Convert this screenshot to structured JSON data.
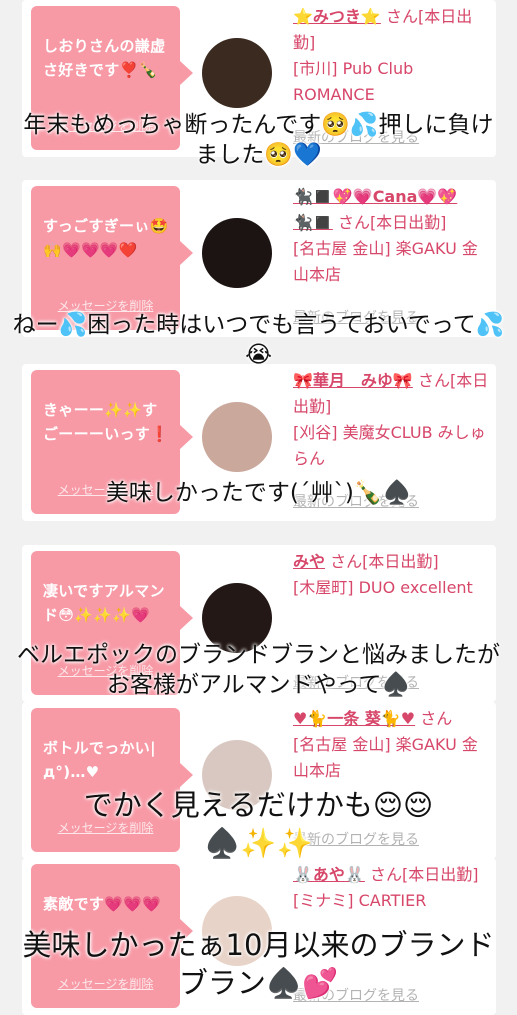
{
  "cards": [
    {
      "bubble_text": "しおりさんの謙虚さ好きです❣️🍾",
      "delete_label": "メッセージを削除",
      "name": "⭐️みつき⭐️",
      "san": "さん[本日出勤]",
      "store": "[市川] Pub Club ROMANCE",
      "blog_label": "最新のブログを見る",
      "avatar_color": "#3a2a20"
    },
    {
      "bubble_text": "すっごすぎーぃ🤩🙌💗💗💗❤️",
      "delete_label": "メッセージを削除",
      "name": "🐈‍⬛◼️💖💗Cana💗💖🐈‍⬛◼️",
      "san": "さん[本日出勤]",
      "store": "[名古屋 金山] 楽GAKU 金山本店",
      "blog_label": "最新のブログを見る",
      "avatar_color": "#1b1412"
    },
    {
      "bubble_text": "きゃーー✨✨すごーーーいっす❗️",
      "delete_label": "メッセージを削除",
      "name": "🎀華月　みゆ🎀",
      "san": "さん[本日出勤]",
      "store": "[刈谷] 美魔女CLUB みしゅらん",
      "blog_label": "最新のブログを見る",
      "avatar_color": "#caa89c"
    },
    {
      "bubble_text": "凄いですアルマンド😳✨✨✨💗",
      "delete_label": "メッセージを削除",
      "name": "みや",
      "san": "さん[本日出勤]",
      "store": "[木屋町] DUO excellent",
      "blog_label": "最新のブログを見る",
      "avatar_color": "#231815"
    },
    {
      "bubble_text": "ボトルでっかい|д°)…♥",
      "delete_label": "メッセージを削除",
      "name": "♥🐈一条 葵🐈♥",
      "san": "さん",
      "store": "[名古屋 金山] 楽GAKU 金山本店",
      "blog_label": "最新のブログを見る",
      "avatar_color": "#d9c8c1"
    },
    {
      "bubble_text": "素敵です💗💗💗",
      "delete_label": "メッセージを削除",
      "name": "🐰あや🐰",
      "san": "さん[本日出勤]",
      "store": "[ミナミ] CARTIER",
      "blog_label": "最新のブログを見る",
      "avatar_color": "#e8d3c8"
    }
  ],
  "captions": [
    "年末もめっちゃ断ったんです🥺💦押しに負けました🥺💙",
    "ねー💦困った時はいつでも言うておいでって💦😭",
    "美味しかったです(´艸`)🍾♠️",
    "ベルエポックのブランドブランと悩みましたがお客様がアルマンドやって♠️",
    "でかく見えるだけかも😌😌♠️✨✨",
    "美味しかったぁ10月以来のブランドブラン♠️💕"
  ]
}
